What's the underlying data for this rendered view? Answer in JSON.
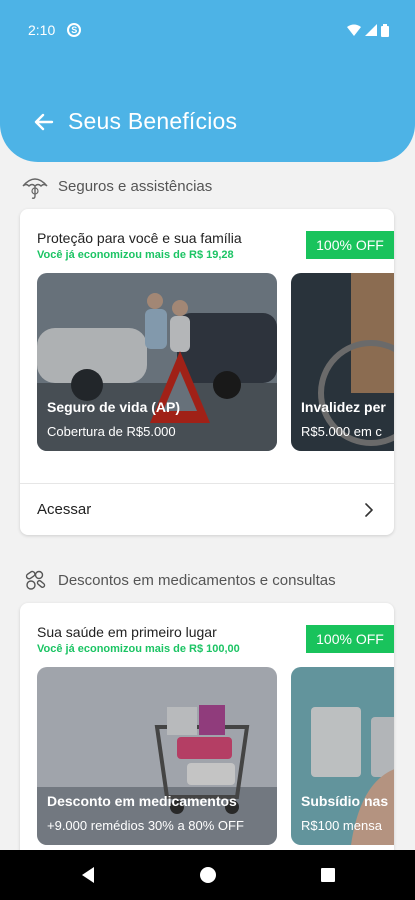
{
  "status_bar": {
    "time": "2:10",
    "app_icon": "s-circle-icon",
    "wifi_icon": "wifi-icon",
    "signal_icon": "signal-icon",
    "battery_icon": "battery-icon"
  },
  "header": {
    "title": "Seus Benefícios",
    "back_icon": "arrow-left-icon",
    "color": "#4db3e6"
  },
  "sections": [
    {
      "heading": "Seguros e assistências",
      "icon": "umbrella-icon",
      "card": {
        "title": "Proteção para você e sua família",
        "savings": "Você já economizou mais de R$ 19,28",
        "badge": "100% OFF",
        "tiles": [
          {
            "title": "Seguro de vida (AP)",
            "subtitle": "Cobertura de R$5.000"
          },
          {
            "title": "Invalidez per",
            "subtitle": "R$5.000 em c"
          }
        ],
        "action_label": "Acessar"
      }
    },
    {
      "heading": "Descontos em medicamentos e consultas",
      "icon": "pills-icon",
      "card": {
        "title": "Sua saúde em primeiro lugar",
        "savings": "Você já economizou mais de R$ 100,00",
        "badge": "100% OFF",
        "tiles": [
          {
            "title": "Desconto em medicamentos",
            "subtitle": "+9.000 remédios 30% a 80% OFF"
          },
          {
            "title": "Subsídio nas",
            "subtitle": "R$100 mensa"
          }
        ]
      }
    }
  ],
  "colors": {
    "accent_green": "#19c35c",
    "savings_green": "#1cc464",
    "background": "#f2f2f2"
  },
  "nav_bar": {
    "back_icon": "triangle-back-icon",
    "home_icon": "circle-home-icon",
    "recents_icon": "square-recents-icon"
  }
}
